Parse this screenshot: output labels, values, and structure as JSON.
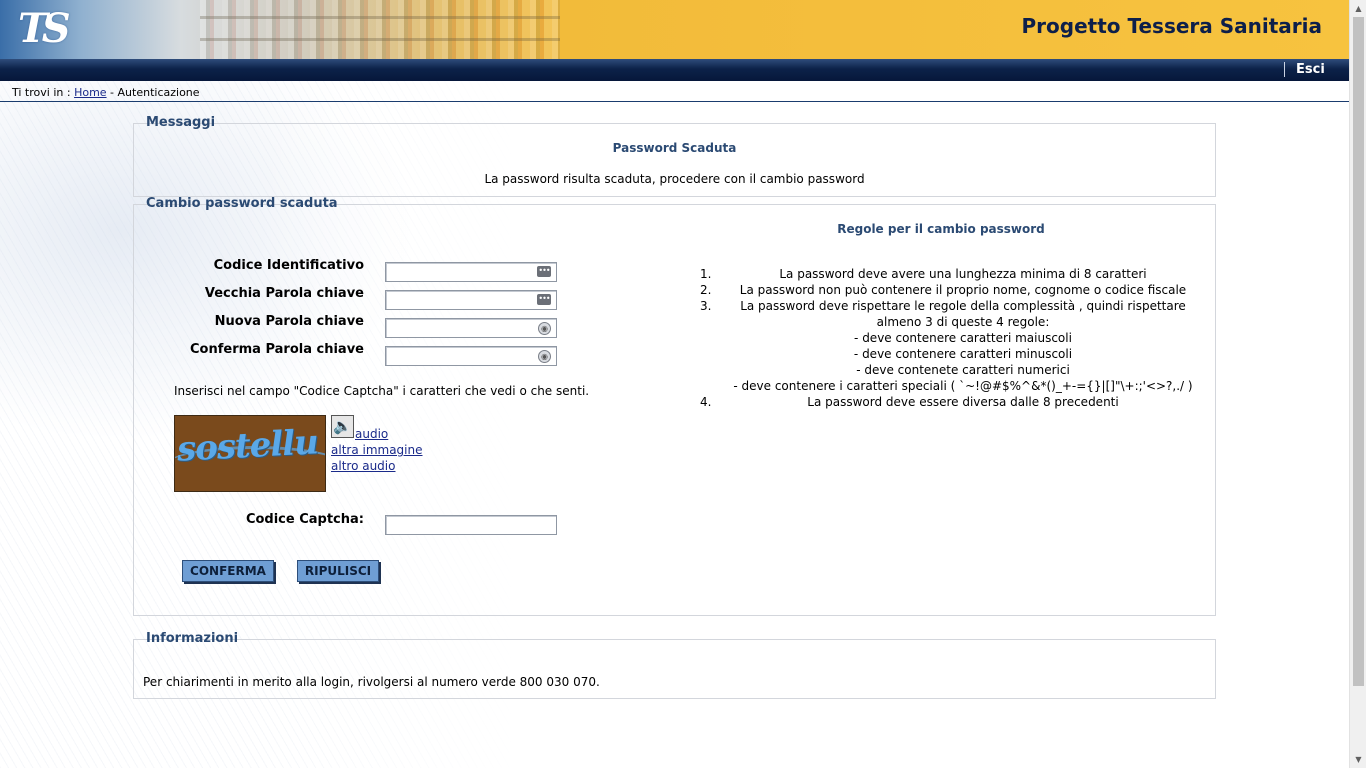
{
  "header": {
    "logo_text": "TS",
    "site_title": "Progetto Tessera Sanitaria",
    "exit_label": "Esci"
  },
  "breadcrumb": {
    "prefix": "Ti trovi in :",
    "home_label": "Home",
    "separator": "-",
    "current": "Autenticazione"
  },
  "messages": {
    "legend": "Messaggi",
    "title": "Password Scaduta",
    "text": "La password risulta scaduta, procedere con il cambio password"
  },
  "form": {
    "legend": "Cambio password scaduta",
    "fields": [
      {
        "label": "Codice Identificativo",
        "value": "",
        "icon": "keyboard-icon"
      },
      {
        "label": "Vecchia Parola chiave",
        "value": "",
        "icon": "keyboard-icon"
      },
      {
        "label": "Nuova Parola chiave",
        "value": "",
        "icon": "key-icon"
      },
      {
        "label": "Conferma Parola chiave",
        "value": "",
        "icon": "key-icon"
      }
    ],
    "captcha_instruction": "Inserisci nel campo \"Codice Captcha\" i caratteri che vedi o che senti.",
    "captcha_image_text": "sostellu",
    "audio_label": "audio",
    "other_image_label": "altra immagine",
    "other_audio_label": "altro audio",
    "captcha_label": "Codice Captcha:",
    "captcha_value": "",
    "confirm_button": "CONFERMA",
    "clear_button": "RIPULISCI"
  },
  "rules": {
    "title": "Regole per il cambio password",
    "items": [
      {
        "num": "1.",
        "text": "La password deve avere una lunghezza minima di 8 caratteri"
      },
      {
        "num": "2.",
        "text": "La password non può contenere il proprio nome, cognome o codice fiscale"
      },
      {
        "num": "3.",
        "text": "La password deve rispettare le regole della complessità , quindi rispettare almeno 3 di queste 4 regole:"
      },
      {
        "num": "4.",
        "text": "La password deve essere diversa dalle 8 precedenti"
      }
    ],
    "subrules": [
      "- deve contenere caratteri maiuscoli",
      "- deve contenere caratteri minuscoli",
      "- deve contenete caratteri numerici",
      "- deve contenere i caratteri speciali ( `~!@#$%^&*()_+-={}|[]\"\\+:;'<>?,./ )"
    ]
  },
  "info": {
    "legend": "Informazioni",
    "text": "Per chiarimenti in merito alla login, rivolgersi al numero verde 800 030 070."
  }
}
